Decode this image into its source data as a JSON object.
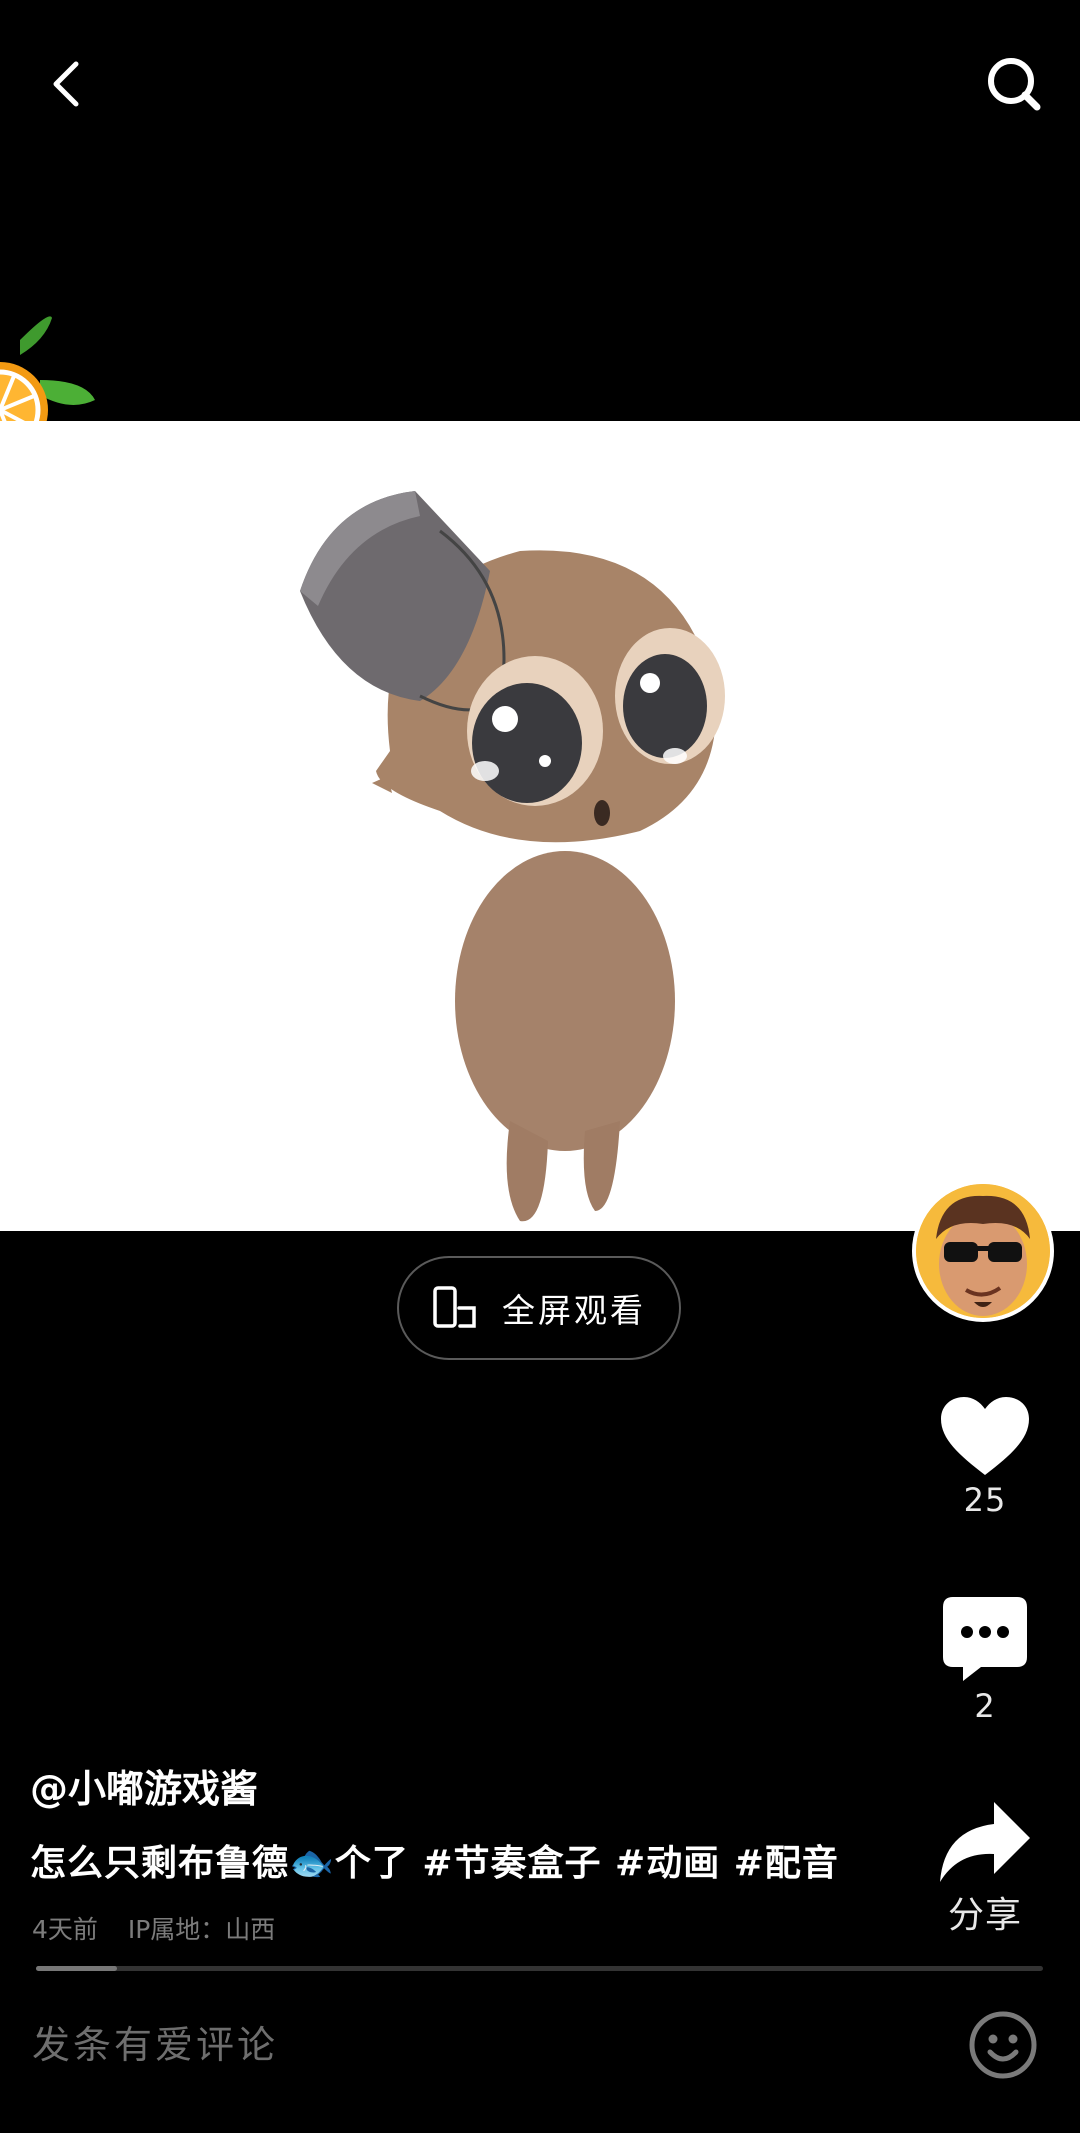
{
  "video": {
    "fullscreen_label": "全屏观看",
    "progress": 0.08
  },
  "actions": {
    "like_count": "25",
    "comment_count": "2",
    "share_label": "分享"
  },
  "post": {
    "author": "@小嘟游戏酱",
    "caption": "怎么只剩布鲁德🐟个了 #节奏盒子 #动画 #配音",
    "time": "4天前",
    "ip_location": "IP属地：山西"
  },
  "comment_bar": {
    "placeholder": "发条有爱评论"
  },
  "icons": {
    "back": "chevron-left-icon",
    "search": "search-icon",
    "fullscreen": "phone-rotate-icon",
    "like": "heart-icon",
    "comment": "chat-bubble-icon",
    "share": "share-arrow-icon",
    "emoji": "smiley-icon"
  }
}
